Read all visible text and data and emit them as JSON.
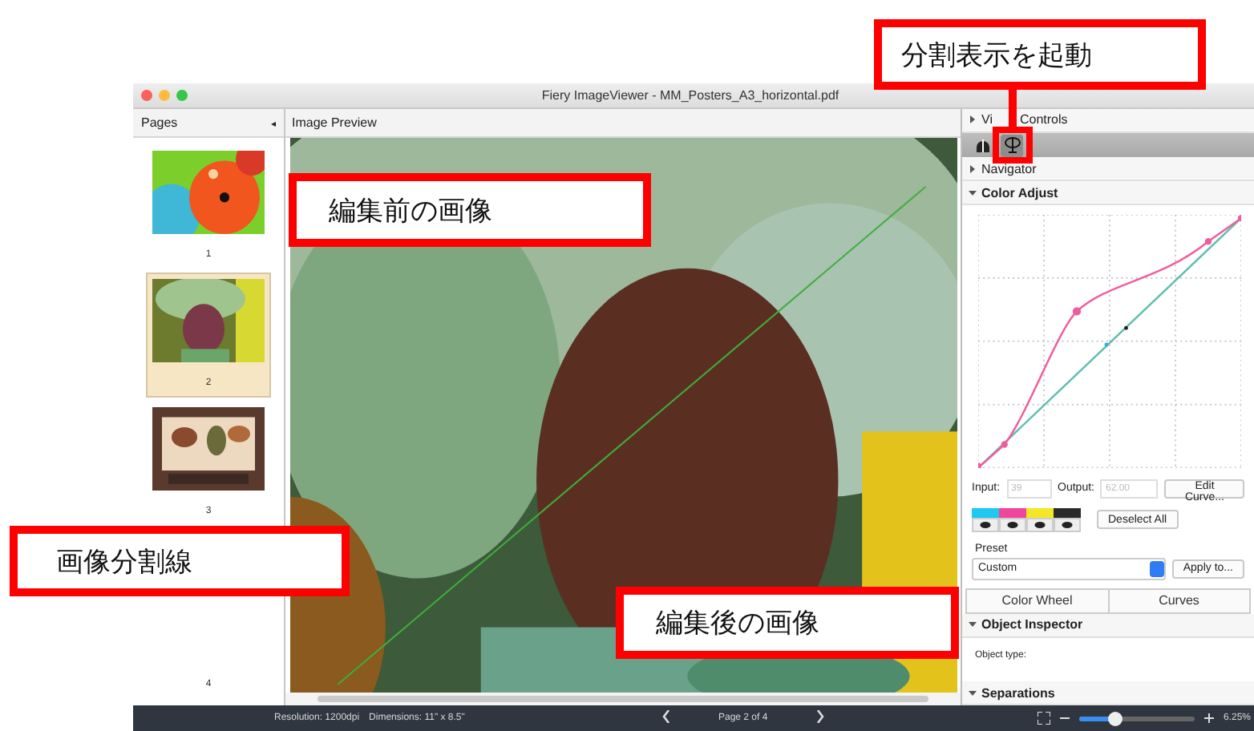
{
  "window": {
    "title": "Fiery ImageViewer - MM_Posters_A3_horizontal.pdf"
  },
  "pages_panel": {
    "title": "Pages",
    "collapse_icon": "◂",
    "pages": [
      {
        "number": "1",
        "selected": false
      },
      {
        "number": "2",
        "selected": true
      },
      {
        "number": "3",
        "selected": false
      },
      {
        "number": "4",
        "selected": false
      }
    ]
  },
  "preview": {
    "title": "Image Preview"
  },
  "right_panel": {
    "sections": [
      {
        "title_fragments": [
          "Vi",
          "Controls"
        ],
        "expanded": false
      },
      {
        "title_fragments": [
          "Navigator"
        ],
        "expanded": false
      },
      {
        "title_fragments": [
          "Color Adjust"
        ],
        "expanded": true
      }
    ],
    "curve_controls": {
      "input_label": "Input:",
      "input_value": "39",
      "output_label": "Output:",
      "output_value": "62.00",
      "edit_button": "Edit Curve..."
    },
    "channels": [
      {
        "color": "#1ec8f0"
      },
      {
        "color": "#f0459a"
      },
      {
        "color": "#f5e626"
      },
      {
        "color": "#2a2a2a"
      }
    ],
    "deselect_button": "Deselect All",
    "preset": {
      "label": "Preset",
      "value": "Custom",
      "apply_button": "Apply to..."
    },
    "tabs": [
      {
        "label": "Color Wheel",
        "selected": false
      },
      {
        "label": "Curves",
        "selected": false
      }
    ],
    "object_inspector": {
      "title_fragments": [
        "Object Inspector"
      ],
      "expanded": true,
      "field_label": "Object type:"
    },
    "separations": {
      "title_fragments": [
        "Separations"
      ],
      "expanded": true
    }
  },
  "status_bar": {
    "resolution": "Resolution: 1200dpi",
    "dimensions": "Dimensions: 11\" x 8.5\"",
    "page": "Page 2 of 4",
    "zoom_slider": {
      "level": 0.3
    },
    "zoom": "6.25%"
  },
  "callouts": [
    {
      "text": "分割表示を起動",
      "kind": "leader"
    },
    {
      "text": "編集前の画像",
      "kind": "plain"
    },
    {
      "text": "画像分割線",
      "kind": "plain"
    },
    {
      "text": "編集後の画像",
      "kind": "plain"
    }
  ]
}
